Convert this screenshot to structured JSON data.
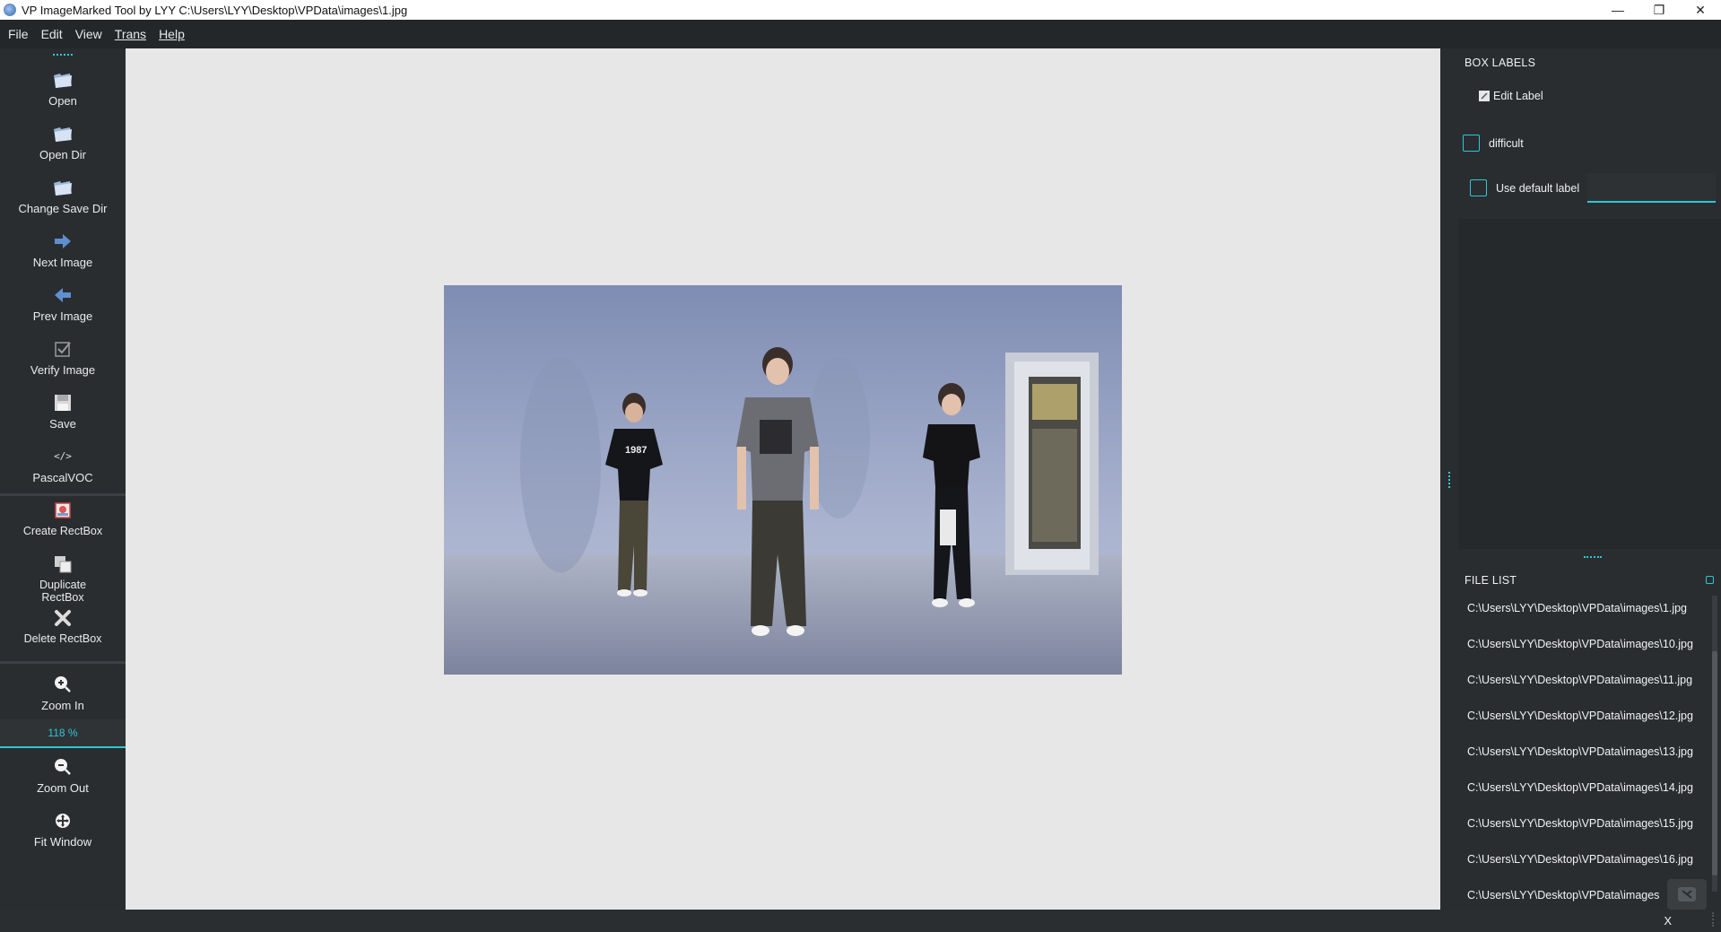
{
  "window": {
    "title": "VP ImageMarked Tool by LYY C:\\Users\\LYY\\Desktop\\VPData\\images\\1.jpg",
    "minimize": "—",
    "maximize": "❐",
    "close": "✕"
  },
  "menu": [
    "File",
    "Edit",
    "View",
    "Trans",
    "Help"
  ],
  "toolbar": {
    "open": "Open",
    "open_dir": "Open Dir",
    "change_save_dir": "Change Save Dir",
    "next_image": "Next Image",
    "prev_image": "Prev Image",
    "verify_image": "Verify Image",
    "save": "Save",
    "format": "PascalVOC",
    "create_rectbox": "Create RectBox",
    "duplicate_rectbox": "Duplicate RectBox",
    "delete_rectbox": "Delete RectBox",
    "zoom_in": "Zoom In",
    "zoom_value": "118 %",
    "zoom_out": "Zoom Out",
    "fit_window": "Fit Window"
  },
  "box_labels": {
    "title": "BOX LABELS",
    "edit_label": "Edit Label",
    "difficult": "difficult",
    "use_default_label": "Use default label",
    "default_label_value": ""
  },
  "file_list": {
    "title": "FILE LIST",
    "items": [
      "C:\\Users\\LYY\\Desktop\\VPData\\images\\1.jpg",
      "C:\\Users\\LYY\\Desktop\\VPData\\images\\10.jpg",
      "C:\\Users\\LYY\\Desktop\\VPData\\images\\11.jpg",
      "C:\\Users\\LYY\\Desktop\\VPData\\images\\12.jpg",
      "C:\\Users\\LYY\\Desktop\\VPData\\images\\13.jpg",
      "C:\\Users\\LYY\\Desktop\\VPData\\images\\14.jpg",
      "C:\\Users\\LYY\\Desktop\\VPData\\images\\15.jpg",
      "C:\\Users\\LYY\\Desktop\\VPData\\images\\16.jpg",
      "C:\\Users\\LYY\\Desktop\\VPData\\images"
    ]
  },
  "image": {
    "shirt_text_1": "1987"
  },
  "status": {
    "close": "X"
  },
  "colors": {
    "accent": "#2ec7d6",
    "panel": "#2a2d30",
    "canvas": "#e7e7e7"
  }
}
